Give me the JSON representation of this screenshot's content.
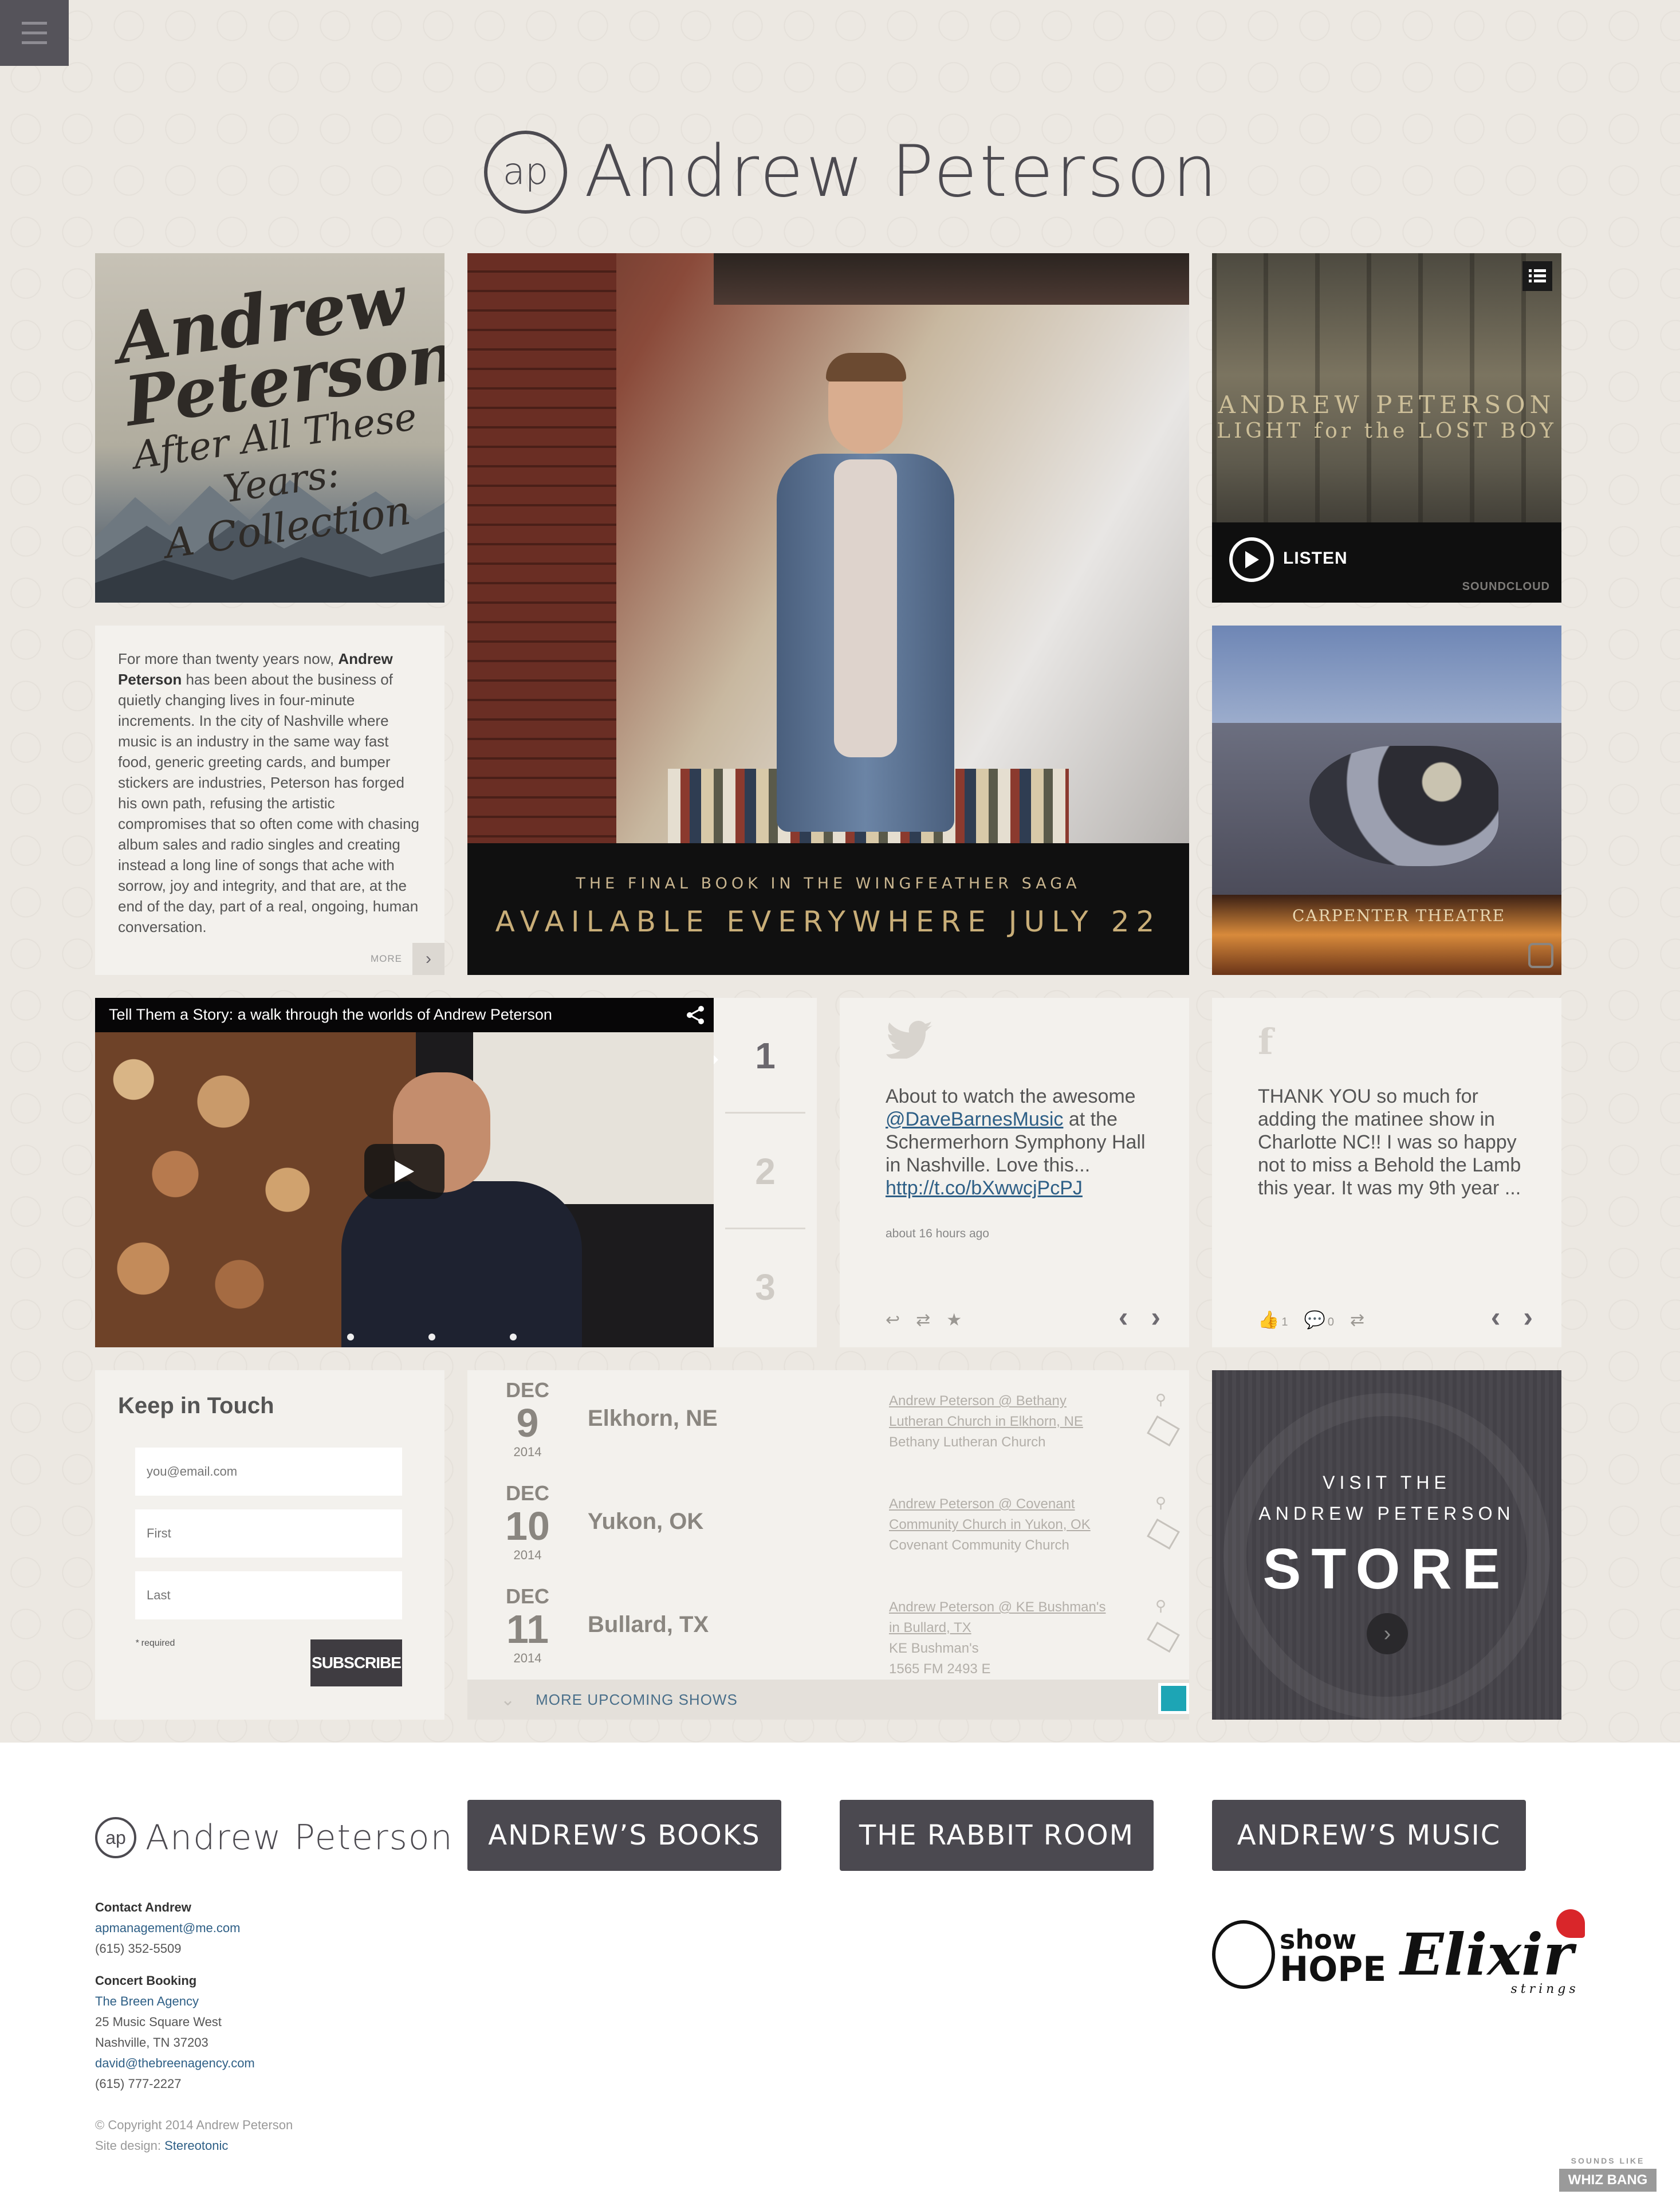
{
  "header": {
    "menu_label": "menu",
    "logo_mark": "ap",
    "site_name": "Andrew Peterson"
  },
  "album_tile": {
    "line1": "Andrew",
    "line2": "Peterson",
    "line3": "After All These Years:",
    "line4": "A Collection"
  },
  "bio": {
    "text_before": "For more than twenty years now, ",
    "bold_name": "Andrew Peterson",
    "text_after": " has been about the business of quietly changing lives in four-minute increments. In the city of Nashville where music is an industry in the same way fast food, generic greeting cards, and bumper stickers are industries, Peterson has forged his own path, refusing the artistic compromises that so often come with chasing album sales and radio singles and creating instead a long line of songs that ache with sorrow, joy and integrity, and that are, at the end of the day, part of a real, ongoing, human conversation.",
    "more_label": "MORE"
  },
  "hero": {
    "subtitle": "THE FINAL BOOK IN THE WINGFEATHER SAGA",
    "headline": "AVAILABLE EVERYWHERE JULY 22"
  },
  "soundcloud": {
    "artist": "ANDREW PETERSON",
    "album": "LIGHT for the LOST BOY",
    "listen_label": "LISTEN",
    "brand": "SOUNDCLOUD"
  },
  "instagram": {
    "sign_text": "CARPENTER THEATRE"
  },
  "video": {
    "title": "Tell Them a Story: a walk through the worlds of Andrew Peterson"
  },
  "pager": {
    "items": [
      "1",
      "2",
      "3"
    ],
    "active": "1"
  },
  "twitter": {
    "text_before": "About to watch the awesome ",
    "mention": "@DaveBarnesMusic",
    "text_middle": " at the Schermerhorn Symphony Hall in Nashville. Love this... ",
    "link": "http://t.co/bXwwcjPcPJ",
    "time": "about 16 hours ago"
  },
  "facebook": {
    "text": "THANK YOU so much for adding the matinee show in Charlotte NC!! I was so happy not to miss a Behold the Lamb this year. It was my 9th year ...",
    "likes": "1",
    "comments": "0"
  },
  "newsletter": {
    "title": "Keep in Touch",
    "email_placeholder": "you@email.com",
    "first_placeholder": "First",
    "last_placeholder": "Last",
    "required_star": "*",
    "required_label": " required",
    "subscribe_label": "SUBSCRIBE"
  },
  "shows": {
    "items": [
      {
        "month": "DEC",
        "day": "9",
        "year": "2014",
        "city": "Elkhorn, NE",
        "event": "Andrew Peterson @ Bethany Lutheran Church in Elkhorn, NE",
        "venue": "Bethany Lutheran Church"
      },
      {
        "month": "DEC",
        "day": "10",
        "year": "2014",
        "city": "Yukon, OK",
        "event": "Andrew Peterson @ Covenant Community Church in Yukon, OK",
        "venue": "Covenant Community Church"
      },
      {
        "month": "DEC",
        "day": "11",
        "year": "2014",
        "city": "Bullard, TX",
        "event": "Andrew Peterson @ KE Bushman's in Bullard, TX",
        "venue": "KE Bushman's",
        "address": "1565 FM 2493 E"
      }
    ],
    "more_label": "MORE UPCOMING SHOWS"
  },
  "store": {
    "line1": "VISIT THE",
    "line2": "ANDREW PETERSON",
    "line3": "STORE"
  },
  "footer": {
    "logo_mark": "ap",
    "site_name": "Andrew Peterson",
    "buttons": [
      "ANDREW’S BOOKS",
      "THE RABBIT ROOM",
      "ANDREW’S MUSIC"
    ],
    "contact_heading": "Contact Andrew",
    "contact_email": "apmanagement@me.com",
    "contact_phone": "(615) 352-5509",
    "booking_heading": "Concert Booking",
    "booking_agency": "The Breen Agency",
    "booking_address1": "25 Music Square West",
    "booking_address2": "Nashville, TN 37203",
    "booking_email": "david@thebreenagency.com",
    "booking_phone": "(615) 777-2227",
    "copyright": "© Copyright 2014 Andrew Peterson",
    "design_label": "Site design: ",
    "design_link": "Stereotonic",
    "partner1_a": "show",
    "partner1_b": "HOPE",
    "partner2": "Elixir",
    "partner2_sub": "strings",
    "credit_small": "SOUNDS LIKE",
    "credit_brand": "WHIZ BANG"
  },
  "colors": {
    "background": "#ece8e2",
    "tile": "#f3f1ed",
    "dark": "#4b4950",
    "link": "#2e5f86",
    "accent_teal": "#1da5b5"
  }
}
